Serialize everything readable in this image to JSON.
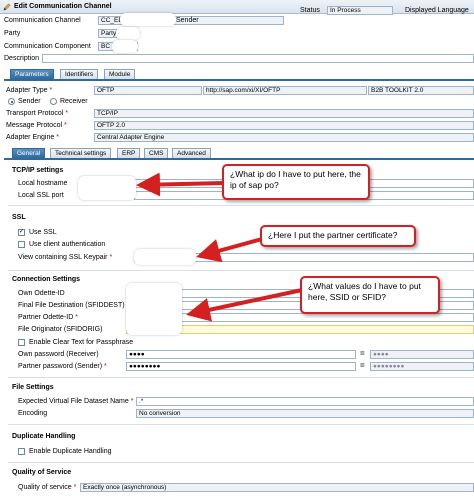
{
  "window": {
    "title": "Edit Communication Channel"
  },
  "header": {
    "communication_channel_label": "Communication Channel",
    "communication_channel_value": "CC_EDI",
    "communication_channel_suffix": "Sender",
    "party_label": "Party",
    "party_value": "Party",
    "communication_component_label": "Communication Component",
    "communication_component_value": "BC",
    "description_label": "Description",
    "status_label": "Status",
    "status_value": "In Process",
    "displayed_language_label": "Displayed Language"
  },
  "main_tabs": [
    {
      "label": "Parameters",
      "active": true
    },
    {
      "label": "Identifiers",
      "active": false
    },
    {
      "label": "Module",
      "active": false
    }
  ],
  "adapter": {
    "adapter_type_label": "Adapter Type",
    "adapter_type_value": "OFTP",
    "adapter_namespace": "http://sap.com/xi/XI/OFTP",
    "adapter_swcv": "B2B TOOLKIT 2.0",
    "sender_label": "Sender",
    "receiver_label": "Receiver",
    "transport_protocol_label": "Transport Protocol",
    "transport_protocol_value": "TCP/IP",
    "message_protocol_label": "Message Protocol",
    "message_protocol_value": "OFTP 2.0",
    "adapter_engine_label": "Adapter Engine",
    "adapter_engine_value": "Central Adapter Engine"
  },
  "sub_tabs": [
    {
      "label": "General",
      "active": true
    },
    {
      "label": "Technical settings",
      "active": false
    },
    {
      "label": "ERP",
      "active": false
    },
    {
      "label": "CMS",
      "active": false
    },
    {
      "label": "Advanced",
      "active": false
    }
  ],
  "tcpip": {
    "heading": "TCP/IP settings",
    "local_hostname_label": "Local hostname",
    "local_ssl_port_label": "Local SSL port"
  },
  "ssl": {
    "heading": "SSL",
    "use_ssl_label": "Use SSL",
    "use_client_auth_label": "Use client authentication",
    "view_keypair_label": "View containing SSL Keypair"
  },
  "connection": {
    "heading": "Connection Settings",
    "own_odette_label": "Own Odette-ID",
    "final_file_dest_label": "Final File Destination (SFIDDEST)",
    "partner_odette_label": "Partner Odette-ID",
    "file_originator_label": "File Originator (SFIDORIG)",
    "enable_clear_text_label": "Enable Clear Text for Passphrase",
    "own_password_label": "Own password (Receiver)",
    "own_password_value": "●●●●",
    "own_password_confirm": "●●●●",
    "partner_password_label": "Partner password (Sender)",
    "partner_password_value": "●●●●●●●●",
    "partner_password_confirm": "●●●●●●●●"
  },
  "file_settings": {
    "heading": "File Settings",
    "expected_vfd_label": "Expected Virtual File Dataset Name",
    "expected_vfd_value": ".*",
    "encoding_label": "Encoding",
    "encoding_value": "No conversion"
  },
  "duplicate": {
    "heading": "Duplicate Handling",
    "enable_label": "Enable Duplicate Handling"
  },
  "qos": {
    "heading": "Quality of Service",
    "label": "Quality of service",
    "value": "Exactly once (asynchronous)"
  },
  "annotations": {
    "callout_1": "¿What ip do I have to put here, the ip of sap po?",
    "callout_2": "¿Here I put the partner certificate?",
    "callout_3": "¿What values do I have to put here, SSID or SFID?"
  },
  "colors": {
    "accent": "#2f6a9f",
    "callout_border": "#d42020",
    "arrow": "#d42020"
  }
}
